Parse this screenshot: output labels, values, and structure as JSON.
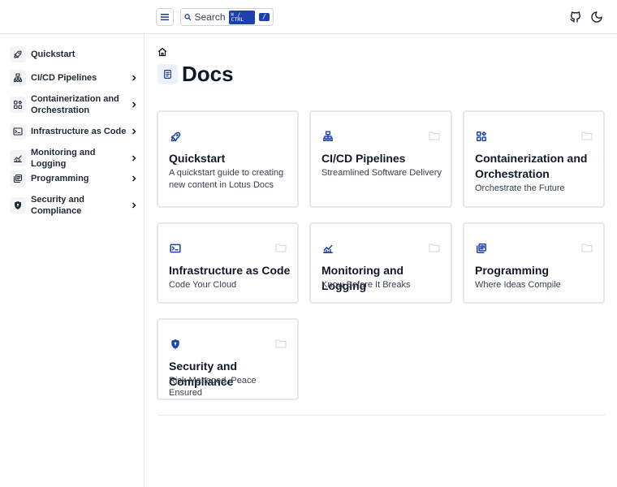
{
  "header": {
    "search_label": "Search",
    "search_shortcut": "⌘ / CTRL",
    "search_slash": "/"
  },
  "sidebar": {
    "items": [
      {
        "label": "Quickstart",
        "icon": "rocket-icon",
        "has_chevron": false
      },
      {
        "label": "CI/CD Pipelines",
        "icon": "pipeline-icon",
        "has_chevron": true
      },
      {
        "label": "Containerization and Orchestration",
        "icon": "containers-icon",
        "has_chevron": true
      },
      {
        "label": "Infrastructure as Code",
        "icon": "terminal-icon",
        "has_chevron": true
      },
      {
        "label": "Monitoring and Logging",
        "icon": "chart-line-icon",
        "has_chevron": true
      },
      {
        "label": "Programming",
        "icon": "books-icon",
        "has_chevron": true
      },
      {
        "label": "Security and Compliance",
        "icon": "shield-icon",
        "has_chevron": true
      }
    ]
  },
  "main": {
    "title": "Docs",
    "cards": [
      {
        "title": "Quickstart",
        "desc": "A quickstart guide to creating new content in Lotus Docs",
        "icon": "rocket-icon"
      },
      {
        "title": "CI/CD Pipelines",
        "desc": "Streamlined Software Delivery",
        "icon": "pipeline-icon"
      },
      {
        "title": "Containerization and Orchestration",
        "desc": "Orchestrate the Future",
        "icon": "containers-icon"
      },
      {
        "title": "Infrastructure as Code",
        "desc": "Code Your Cloud",
        "icon": "terminal-icon"
      },
      {
        "title": "Monitoring and Logging",
        "desc": "Know Before It Breaks",
        "icon": "chart-line-icon"
      },
      {
        "title": "Programming",
        "desc": "Where Ideas Compile",
        "icon": "books-icon"
      },
      {
        "title": "Security and Compliance",
        "desc": "Risk Managed, Peace Ensured",
        "icon": "shield-icon"
      }
    ]
  },
  "colors": {
    "accent": "#1e40af",
    "border": "#e5e7eb",
    "text": "#111827"
  }
}
